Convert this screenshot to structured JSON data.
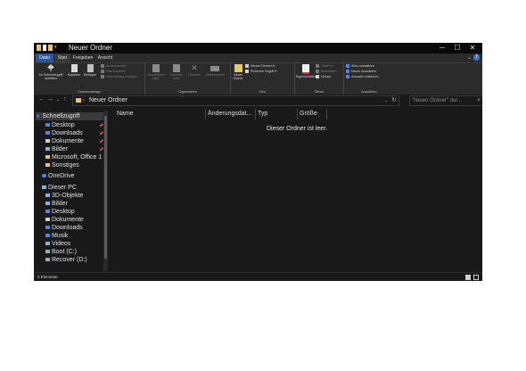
{
  "window": {
    "title": "Neuer Ordner",
    "controls": {
      "minimize": "─",
      "maximize": "☐",
      "close": "✕"
    }
  },
  "tabs": [
    "Datei",
    "Start",
    "Freigeben",
    "Ansicht"
  ],
  "ribbon": {
    "clipboard": {
      "group_label": "Zwischenablage",
      "pin": "An Schnellzugriff anheften",
      "copy": "Kopieren",
      "paste": "Einfügen",
      "cut": "Ausschneiden",
      "copy_path": "Pfad kopieren",
      "paste_shortcut": "Verknüpfung einfügen"
    },
    "organize": {
      "group_label": "Organisieren",
      "move_to": "Verschieben nach",
      "copy_to": "Kopieren nach",
      "delete": "Löschen",
      "rename": "Umbenennen"
    },
    "new": {
      "group_label": "Neu",
      "new_folder": "Neuer Ordner",
      "new_item": "Neues Element",
      "easy_access": "Einfacher Zugriff"
    },
    "open": {
      "group_label": "Öffnen",
      "properties": "Eigenschaften",
      "open": "Öffnen",
      "edit": "Bearbeiten",
      "history": "Verlauf"
    },
    "select": {
      "group_label": "Auswählen",
      "select_all": "Alles auswählen",
      "select_none": "Nichts auswählen",
      "invert": "Auswahl umkehren"
    }
  },
  "address": {
    "breadcrumb": "Neuer Ordner",
    "search_placeholder": "\"Neuer Ordner\" dur..."
  },
  "navpane": {
    "quick_access": "Schnellzugriff",
    "quick_items": [
      "Desktop",
      "Downloads",
      "Dokumente",
      "Bilder",
      "Microsoft, Office 1",
      "Sonstiges"
    ],
    "onedrive": "OneDrive",
    "this_pc": "Dieser PC",
    "pc_items": [
      "3D-Objekte",
      "Bilder",
      "Desktop",
      "Dokumente",
      "Downloads",
      "Musik",
      "Videos",
      "Boot (C:)",
      "Recover (D:)"
    ]
  },
  "columns": [
    "Name",
    "Änderungsdat...",
    "Typ",
    "Größe"
  ],
  "empty_message": "Dieser Ordner ist leer.",
  "status": {
    "count": "0 Elemente"
  },
  "colors": {
    "accent": "#2b5797",
    "folder": "#e8c46a",
    "background": "#191919",
    "ribbon": "#2b2b2b"
  }
}
